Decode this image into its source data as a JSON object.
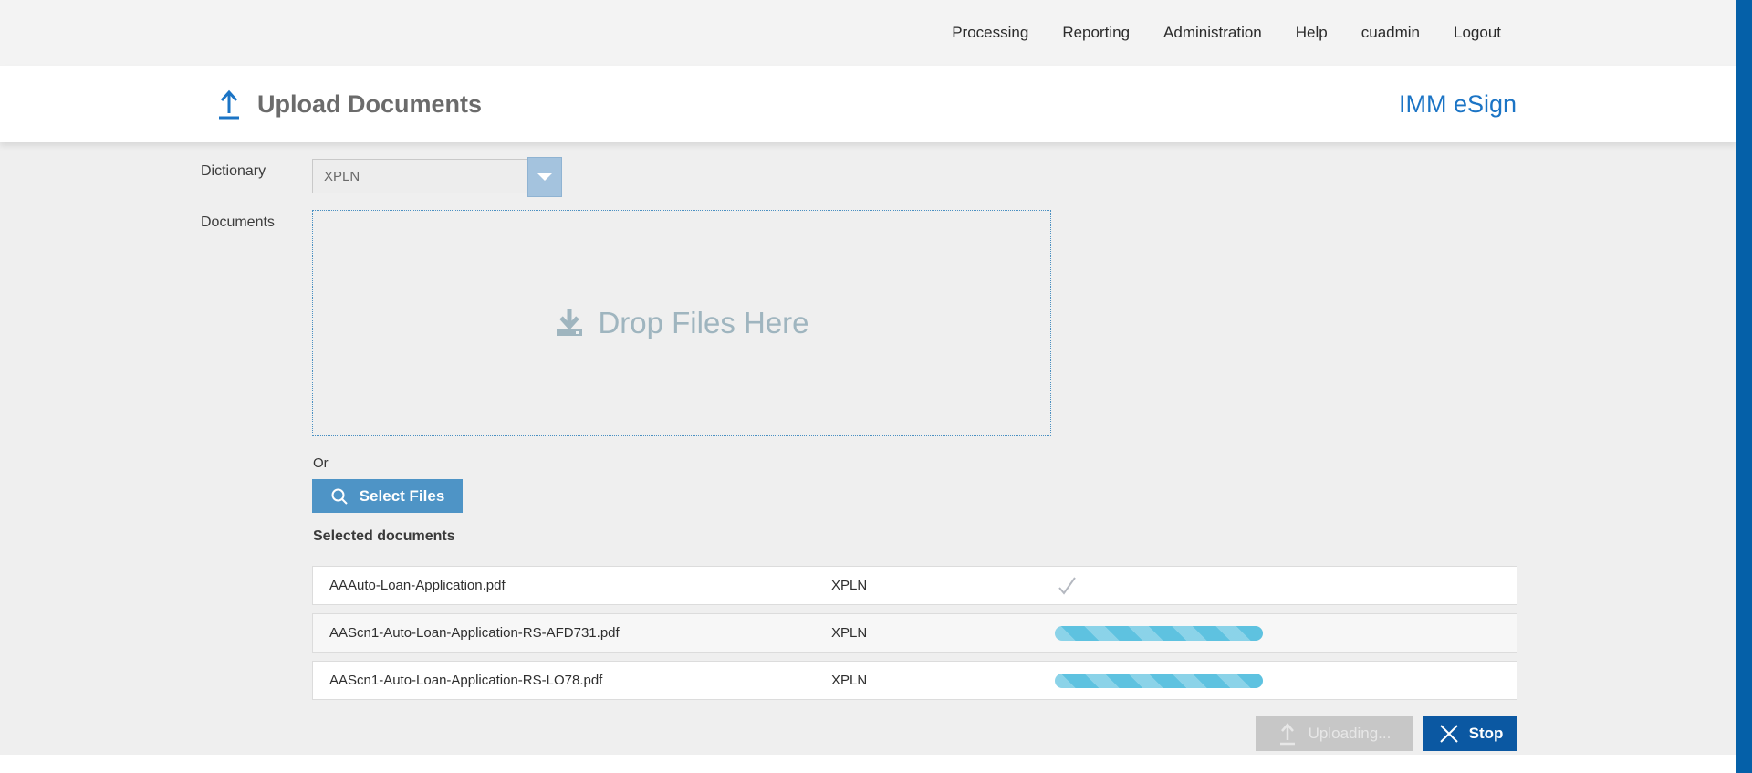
{
  "nav": {
    "items": [
      "Processing",
      "Reporting",
      "Administration",
      "Help",
      "cuadmin",
      "Logout"
    ]
  },
  "header": {
    "title": "Upload Documents",
    "brand": "IMM eSign"
  },
  "form": {
    "dictionary_label": "Dictionary",
    "dictionary_value": "XPLN",
    "documents_label": "Documents",
    "dropzone_text": "Drop Files Here",
    "or_label": "Or",
    "select_files_label": "Select Files"
  },
  "selected_documents": {
    "heading": "Selected documents",
    "rows": [
      {
        "filename": "AAAuto-Loan-Application.pdf",
        "dictionary": "XPLN",
        "status": "complete"
      },
      {
        "filename": "AAScn1-Auto-Loan-Application-RS-AFD731.pdf",
        "dictionary": "XPLN",
        "status": "uploading",
        "progress_percent": 100
      },
      {
        "filename": "AAScn1-Auto-Loan-Application-RS-LO78.pdf",
        "dictionary": "XPLN",
        "status": "uploading",
        "progress_percent": 100
      }
    ]
  },
  "actions": {
    "uploading_label": "Uploading...",
    "stop_label": "Stop"
  },
  "icons": {
    "header": "upload-icon",
    "dropzone": "download-icon",
    "select_files": "search-icon",
    "row_complete": "check-icon",
    "uploading": "upload-icon",
    "stop": "close-icon",
    "dictionary": "chevron-down-icon"
  },
  "colors": {
    "brand_blue": "#1b74c5",
    "button_blue": "#4e94c6",
    "stop_blue": "#0b58a2",
    "progress_blue": "#5ec2e0",
    "scrollbar_blue": "#0560a8",
    "drop_text_gray": "#9fb5bf"
  }
}
